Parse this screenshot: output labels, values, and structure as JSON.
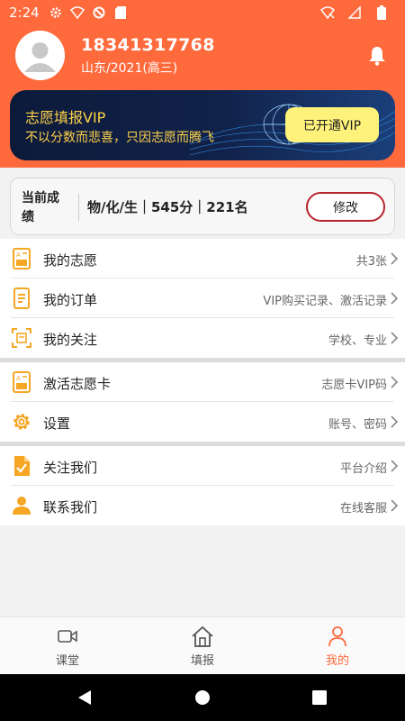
{
  "status": {
    "time": "2:24"
  },
  "profile": {
    "phone": "18341317768",
    "region": "山东/2021(高三)"
  },
  "vip": {
    "title": "志愿填报VIP",
    "subtitle": "不以分数而悲喜，只因志愿而腾飞",
    "button": "已开通VIP"
  },
  "score": {
    "label": "当前成绩",
    "value": "物/化/生｜545分｜221名",
    "edit_button": "修改"
  },
  "menu": {
    "group1": [
      {
        "label": "我的志愿",
        "hint": "共3张",
        "icon": "volunteer-doc-icon"
      },
      {
        "label": "我的订单",
        "hint": "VIP购买记录、激活记录",
        "icon": "order-doc-icon"
      },
      {
        "label": "我的关注",
        "hint": "学校、专业",
        "icon": "focus-scan-icon"
      }
    ],
    "group2": [
      {
        "label": "激活志愿卡",
        "hint": "志愿卡VIP码",
        "icon": "volunteer-card-icon"
      },
      {
        "label": "设置",
        "hint": "账号、密码",
        "icon": "settings-gear-icon"
      }
    ],
    "group3": [
      {
        "label": "关注我们",
        "hint": "平台介绍",
        "icon": "doc-check-icon"
      },
      {
        "label": "联系我们",
        "hint": "在线客服",
        "icon": "person-icon"
      }
    ]
  },
  "bottom_nav": [
    {
      "label": "课堂",
      "icon": "video-camera-icon",
      "active": false
    },
    {
      "label": "填报",
      "icon": "home-icon",
      "active": false
    },
    {
      "label": "我的",
      "icon": "profile-icon",
      "active": true
    }
  ],
  "colors": {
    "accent": "#ff6a3d",
    "vip_text": "#ffd24a",
    "vip_button": "#fff27a",
    "edit_border": "#b8222e",
    "icon_orange": "#f5a623"
  }
}
